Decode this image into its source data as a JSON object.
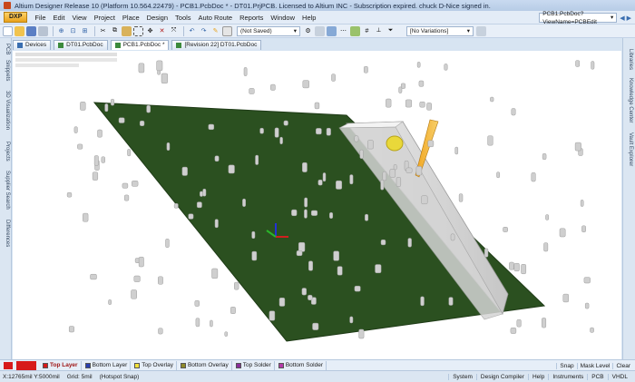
{
  "window": {
    "title": "Altium Designer Release 10 (Platform 10.564.22479) - PCB1.PcbDoc * - DT01.PrjPCB. Licensed to Altium INC - Subscription expired. chuck D-Nice signed in."
  },
  "menu": {
    "dxp_label": "DXP",
    "items": [
      "File",
      "Edit",
      "View",
      "Project",
      "Place",
      "Design",
      "Tools",
      "Auto Route",
      "Reports",
      "Window",
      "Help"
    ],
    "doc_path": "PCB1.PcbDoc?ViewName=PCBEdit"
  },
  "toolbar": {
    "save_state": "(Not Saved)",
    "variants": "[No Variations]"
  },
  "doc_tabs": [
    "Devices",
    "DT01.PcbDoc",
    "PCB1.PcbDoc *",
    "[Revision 22] DT01.PcbDoc"
  ],
  "left_panels": [
    "PCB",
    "Snippets",
    "3D Visualization",
    "Projects",
    "Supplier Search",
    "Differences"
  ],
  "right_panels": [
    "Libraries",
    "Knowledge Center",
    "Vault Explorer"
  ],
  "layers": {
    "tabs": [
      {
        "label": "Top Layer",
        "color": "#d71a1a"
      },
      {
        "label": "Bottom Layer",
        "color": "#2a3fb0"
      },
      {
        "label": "Top Overlay",
        "color": "#f2e23a"
      },
      {
        "label": "Bottom Overlay",
        "color": "#8f8a2a"
      },
      {
        "label": "Top Solder",
        "color": "#8a2e9a"
      },
      {
        "label": "Bottom Solder",
        "color": "#b43aa8"
      }
    ],
    "right_items": [
      "Snap",
      "Mask Level",
      "Clear"
    ]
  },
  "status": {
    "coords": "X:12765mil Y:5000mil",
    "grid": "Grid: 5mil",
    "snap": "(Hotspot Snap)",
    "panels": [
      "System",
      "Design Compiler",
      "Help",
      "Instruments",
      "PCB",
      "VHDL"
    ]
  },
  "colors": {
    "board": "#2b5020",
    "component": "#c9c9c9",
    "accent": "#e8a21b"
  }
}
